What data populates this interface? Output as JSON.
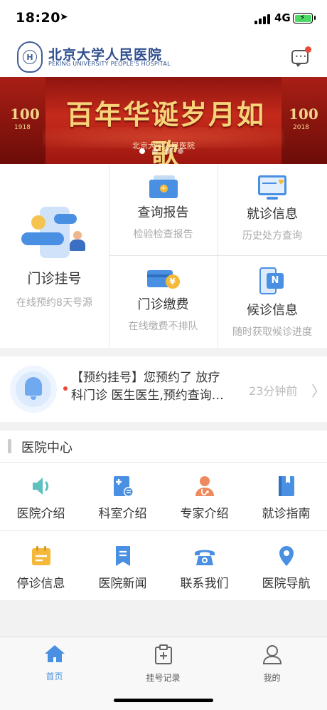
{
  "status_bar": {
    "time": "18:20",
    "network": "4G"
  },
  "header": {
    "logo_mark": "H",
    "hospital_name": "北京大学人民医院",
    "hospital_name_en": "PEKING UNIVERSITY PEOPLE'S HOSPITAL",
    "message_icon": "chat-bubble-icon"
  },
  "banner": {
    "slogan": "百年华诞岁月如歌",
    "subtitle": "北京大学人民医院",
    "left_badge": "100",
    "left_year": "1918",
    "right_badge": "100",
    "right_year": "2018",
    "page_count": 4,
    "active_index": 0
  },
  "services": {
    "register": {
      "title": "门诊挂号",
      "subtitle": "在线预约8天号源"
    },
    "report": {
      "title": "查询报告",
      "subtitle": "检验检查报告"
    },
    "visit": {
      "title": "就诊信息",
      "subtitle": "历史处方查询"
    },
    "payment": {
      "title": "门诊缴费",
      "subtitle": "在线缴费不排队"
    },
    "waiting": {
      "title": "候诊信息",
      "subtitle": "随时获取候诊进度"
    }
  },
  "notice": {
    "line1": "【预约挂号】您预约了 放疗",
    "line2": "科门诊 医生医生,预约查询…",
    "time": "23分钟前"
  },
  "hospital_center": {
    "title": "医院中心",
    "items": [
      {
        "label": "医院介绍",
        "icon": "speaker-icon",
        "color": "#5bc0be"
      },
      {
        "label": "科室介绍",
        "icon": "department-icon",
        "color": "#4a90e2"
      },
      {
        "label": "专家介绍",
        "icon": "doctor-icon",
        "color": "#ef8a5f"
      },
      {
        "label": "就诊指南",
        "icon": "book-icon",
        "color": "#4a90e2"
      },
      {
        "label": "停诊信息",
        "icon": "calendar-icon",
        "color": "#f5b93a"
      },
      {
        "label": "医院新闻",
        "icon": "bookmark-icon",
        "color": "#4a90e2"
      },
      {
        "label": "联系我们",
        "icon": "telephone-icon",
        "color": "#4a90e2"
      },
      {
        "label": "医院导航",
        "icon": "location-pin-icon",
        "color": "#4a90e2"
      }
    ]
  },
  "tabbar": {
    "items": [
      {
        "label": "首页",
        "icon": "home-icon",
        "active": true
      },
      {
        "label": "挂号记录",
        "icon": "clipboard-icon",
        "active": false
      },
      {
        "label": "我的",
        "icon": "user-icon",
        "active": false
      }
    ]
  },
  "colors": {
    "accent": "#4a90e2",
    "brand": "#2f4f8f",
    "banner_red": "#c52a1b",
    "alert": "#e84a3c"
  }
}
